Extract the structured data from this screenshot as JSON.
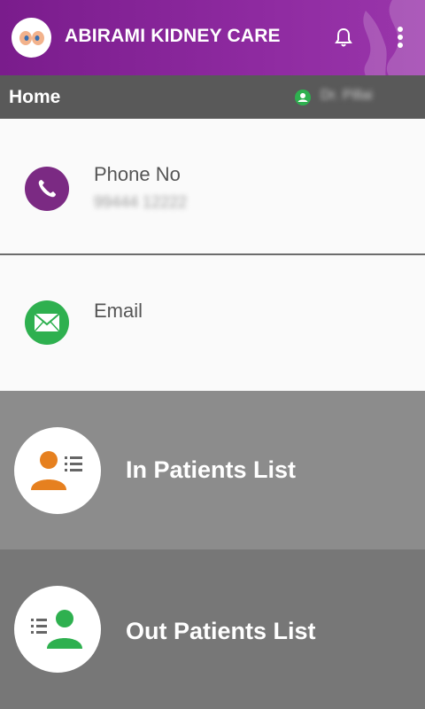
{
  "app": {
    "title": "ABIRAMI KIDNEY CARE",
    "logo_icon": "kidney-logo-icon",
    "notification_icon": "bell-icon",
    "menu_icon": "more-vertical-icon",
    "brand_color": "#7a1c8c"
  },
  "subheader": {
    "title": "Home",
    "user_icon": "user-icon",
    "user_name": "Dr. Pillai"
  },
  "contact": {
    "phone_label": "Phone No",
    "phone_value": "99444 12222",
    "phone_icon": "phone-icon",
    "email_label": "Email",
    "email_value": "",
    "email_icon": "envelope-icon"
  },
  "tiles": {
    "in_patients_label": "In Patients List",
    "in_patients_icon": "patient-list-icon",
    "out_patients_label": "Out Patients List",
    "out_patients_icon": "patient-list-icon"
  }
}
